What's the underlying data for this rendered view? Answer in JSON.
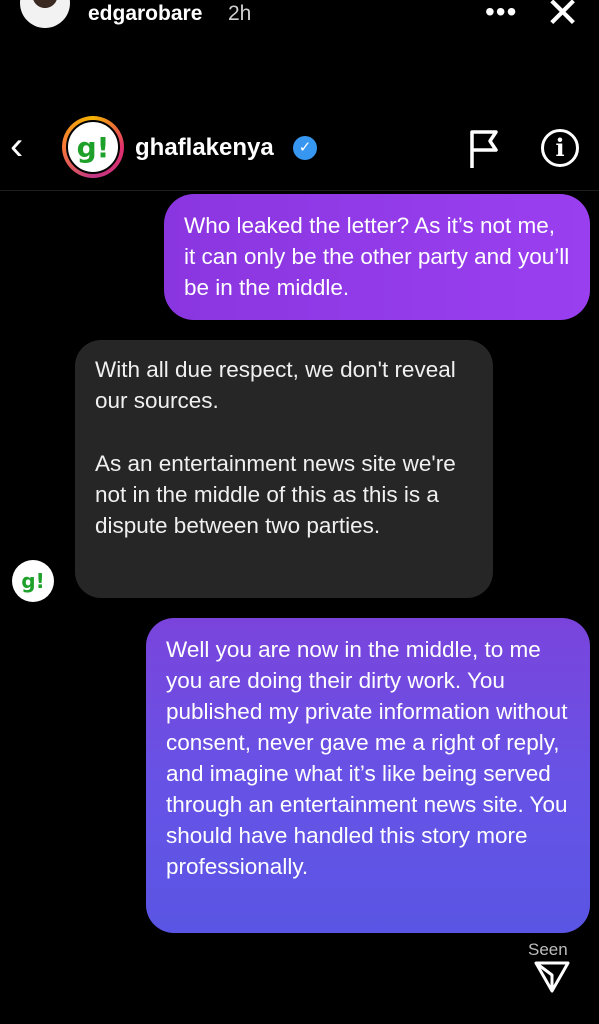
{
  "story": {
    "username": "edgarobare",
    "time": "2h",
    "more_glyph": "•••",
    "close_glyph": "✕"
  },
  "dm_header": {
    "back_glyph": "‹",
    "logo_text": "g!",
    "username": "ghaflakenya",
    "verified_glyph": "✓",
    "info_glyph": "i"
  },
  "messages": [
    {
      "sender": "me",
      "paragraphs": [
        "Who leaked the letter? As it’s not me, it can only be the other party and you’ll be in the middle."
      ]
    },
    {
      "sender": "ghaflakenya",
      "paragraphs": [
        "With all due respect, we don't reveal our sources.",
        "As an entertainment news site we're not in the middle of this as this is a dispute between two parties."
      ]
    },
    {
      "sender": "me",
      "paragraphs": [
        "Well you are now in the middle, to me you are doing their dirty work. You published my private information without consent, never gave me a right of reply, and imagine what it’s like being served through an entertainment news site. You should have handled this story more professionally."
      ]
    }
  ],
  "small_avatar_text": "g!",
  "seen_label": "Seen",
  "colors": {
    "background": "#000000",
    "outgoing_bubble": "#8a36e0",
    "incoming_bubble": "#262626",
    "verified": "#3797f0",
    "logo_green": "#1ea12a"
  },
  "icons": [
    "close-icon",
    "more-icon",
    "back-icon",
    "verified-icon",
    "flag-icon",
    "info-icon",
    "send-icon"
  ]
}
